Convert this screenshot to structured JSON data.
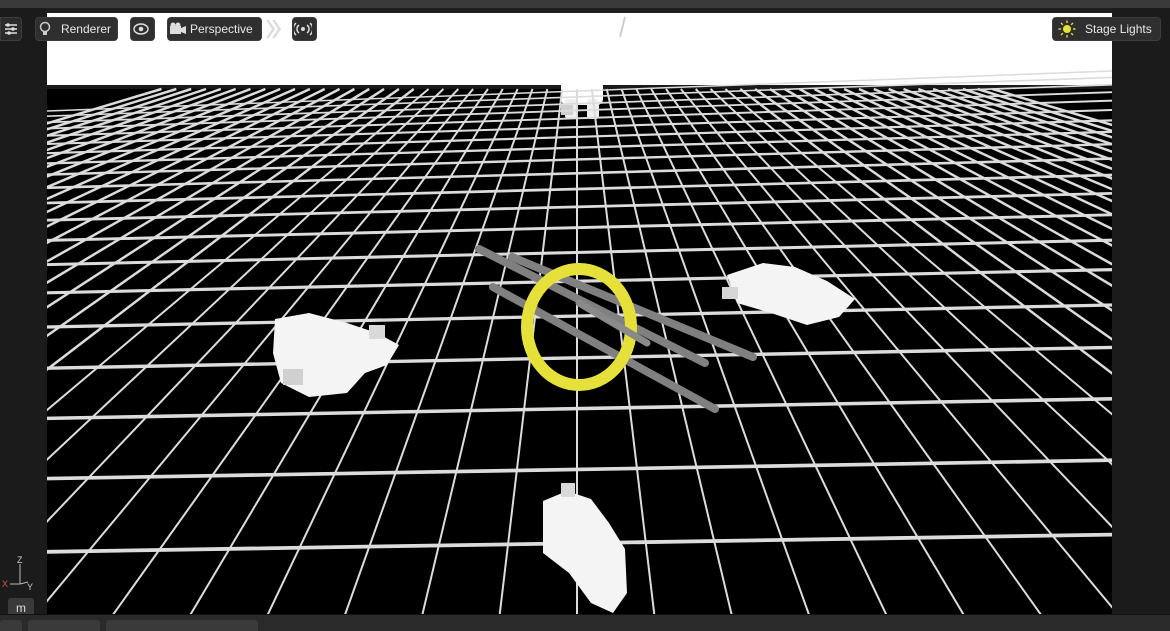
{
  "toolbar": {
    "renderer_label": "Renderer",
    "camera_label": "Perspective",
    "lights_label": "Stage Lights",
    "icons": [
      "settings-sliders-icon",
      "lightbulb-icon",
      "eye-icon",
      "camera-icon",
      "double-chevron-icon",
      "broadcast-icon",
      "sun-icon"
    ]
  },
  "viewport": {
    "background_color": "#000000",
    "sky_color": "#ffffff",
    "grid_color": "#e6e6e6",
    "handle_color": "#e6e03a"
  },
  "axis_gizmo": {
    "z": "Z",
    "x": "X",
    "y": "Y"
  },
  "mode_button": "m"
}
